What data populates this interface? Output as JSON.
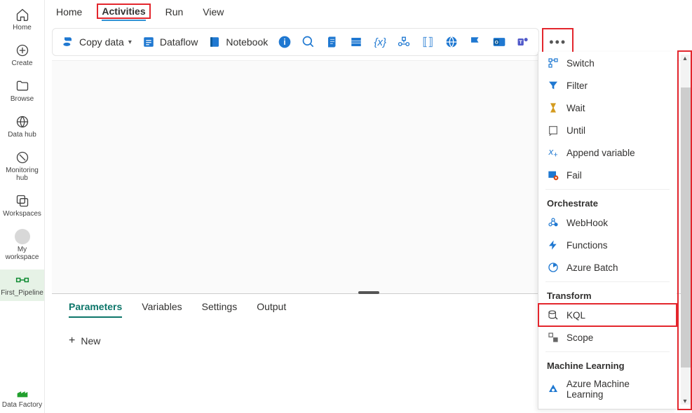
{
  "nav": {
    "items": [
      {
        "id": "home",
        "label": "Home",
        "icon": "home-icon"
      },
      {
        "id": "create",
        "label": "Create",
        "icon": "plus-circle-icon"
      },
      {
        "id": "browse",
        "label": "Browse",
        "icon": "folder-icon"
      },
      {
        "id": "datahub",
        "label": "Data hub",
        "icon": "datahub-icon"
      },
      {
        "id": "monitoring",
        "label": "Monitoring hub",
        "icon": "monitoring-icon"
      },
      {
        "id": "workspaces",
        "label": "Workspaces",
        "icon": "workspaces-icon"
      },
      {
        "id": "myworkspace",
        "label": "My workspace",
        "icon": "avatar-icon"
      },
      {
        "id": "pipeline",
        "label": "First_Pipeline",
        "icon": "pipeline-icon",
        "active": true
      },
      {
        "id": "datafactory",
        "label": "Data Factory",
        "icon": "datafactory-icon"
      }
    ]
  },
  "top_tabs": {
    "items": [
      "Home",
      "Activities",
      "Run",
      "View"
    ],
    "active": "Activities"
  },
  "toolbar": {
    "copydata": "Copy data",
    "dataflow": "Dataflow",
    "notebook": "Notebook"
  },
  "bottom_tabs": {
    "items": [
      "Parameters",
      "Variables",
      "Settings",
      "Output"
    ],
    "active": "Parameters",
    "new_label": "New"
  },
  "dropdown": {
    "sections": [
      {
        "heading": null,
        "items": [
          {
            "label": "Switch",
            "icon": "switch-icon"
          },
          {
            "label": "Filter",
            "icon": "filter-icon"
          },
          {
            "label": "Wait",
            "icon": "wait-icon"
          },
          {
            "label": "Until",
            "icon": "until-icon"
          },
          {
            "label": "Append variable",
            "icon": "append-variable-icon"
          },
          {
            "label": "Fail",
            "icon": "fail-icon"
          }
        ]
      },
      {
        "heading": "Orchestrate",
        "items": [
          {
            "label": "WebHook",
            "icon": "webhook-icon"
          },
          {
            "label": "Functions",
            "icon": "functions-icon"
          },
          {
            "label": "Azure Batch",
            "icon": "azure-batch-icon"
          }
        ]
      },
      {
        "heading": "Transform",
        "items": [
          {
            "label": "KQL",
            "icon": "kql-icon",
            "highlight": true
          },
          {
            "label": "Scope",
            "icon": "scope-icon"
          }
        ]
      },
      {
        "heading": "Machine Learning",
        "items": [
          {
            "label": "Azure Machine Learning",
            "icon": "ml-icon"
          }
        ]
      }
    ]
  }
}
